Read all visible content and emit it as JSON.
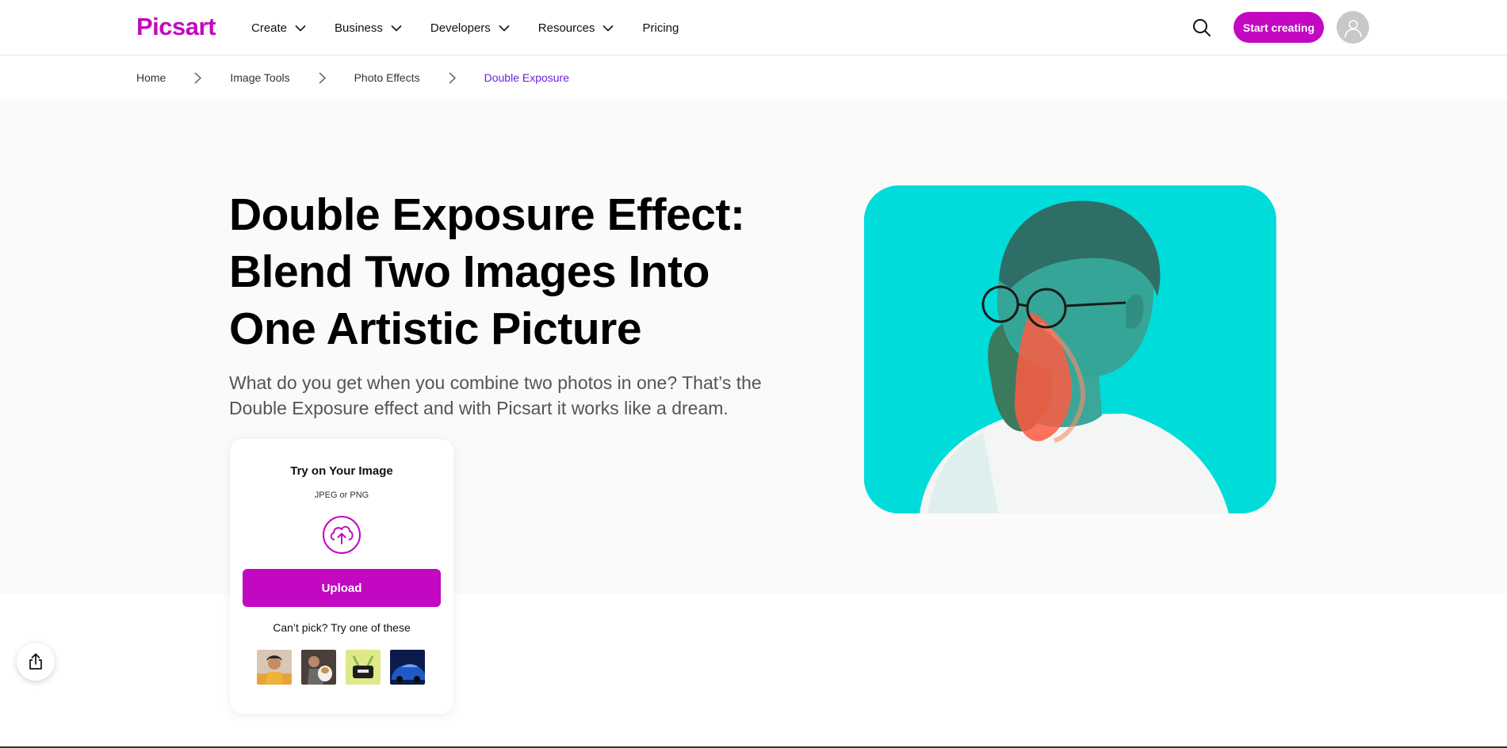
{
  "brand": {
    "name": "Picsart",
    "accent": "#c209c1",
    "link_color": "#6c1ee0"
  },
  "nav": {
    "items": [
      {
        "label": "Create",
        "has_dropdown": true
      },
      {
        "label": "Business",
        "has_dropdown": true
      },
      {
        "label": "Developers",
        "has_dropdown": true
      },
      {
        "label": "Resources",
        "has_dropdown": true
      },
      {
        "label": "Pricing",
        "has_dropdown": false
      }
    ],
    "search_icon": "search-icon",
    "start_label": "Start creating",
    "avatar_icon": "user-icon"
  },
  "breadcrumb": [
    "Home",
    "Image Tools",
    "Photo Effects",
    "Double Exposure"
  ],
  "hero": {
    "title_lines": [
      "Double Exposure Effect:",
      "Blend Two Images Into",
      "One Artistic Picture"
    ],
    "subtitle": "What do you get when you combine two photos in one? That’s the Double Exposure effect and with Picsart it works like a dream."
  },
  "upload_card": {
    "title": "Try on Your Image",
    "formats": "JPEG or PNG",
    "upload_icon": "cloud-upload-icon",
    "upload_label": "Upload",
    "try_label": "Can’t pick? Try one of these"
  },
  "share_icon": "share-icon"
}
